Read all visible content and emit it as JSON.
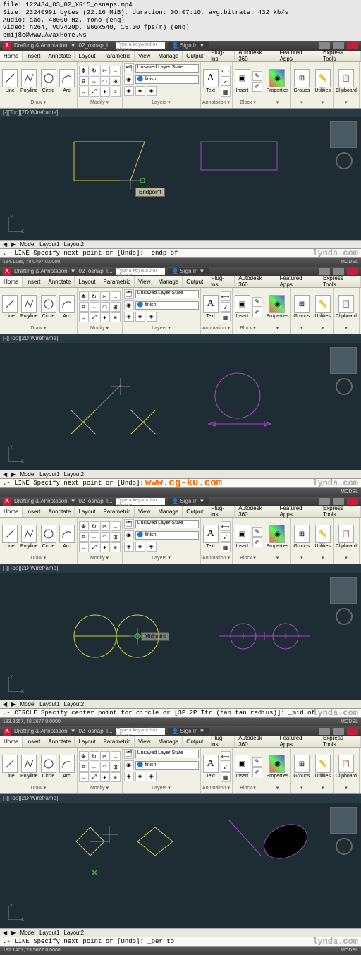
{
  "metadata": {
    "line1": "file: 122434_03_02_XR15_osnaps.mp4",
    "line2": "Size: 23240991 bytes (22.16 MiB), duration: 00:07:10, avg.bitrate: 432 kb/s",
    "line3": "Audio: aac, 48000 Hz, mono (eng)",
    "line4": "Video: h264, yuv420p, 960x540, 15.00 fps(r) (eng)",
    "line5": "emij8o@www.AvaxHome.ws"
  },
  "titlebar": {
    "workspace": "Drafting & Annotation",
    "doc": "02_osnap_l...",
    "search_placeholder": "Type a keyword or phrase",
    "signin": "Sign In"
  },
  "menus": [
    "Home",
    "Insert",
    "Annotate",
    "Layout",
    "Parametric",
    "View",
    "Manage",
    "Output",
    "Plug-ins",
    "Autodesk 360",
    "Featured Apps",
    "Express Tools"
  ],
  "tabs_ribbon": [
    "Home",
    "Insert",
    "Annotate",
    "Layout",
    "Parametric",
    "View",
    "Manage",
    "Output",
    "Plug-ins",
    "Autodesk 360",
    "Featured Apps",
    "Express Tools"
  ],
  "ribbon_groups": {
    "draw": {
      "title": "Draw ▾",
      "tools": [
        "Line",
        "Polyline",
        "Circle",
        "Arc"
      ]
    },
    "modify": {
      "title": "Modify ▾"
    },
    "layers": {
      "title": "Layers ▾",
      "combo": "Unsaved Layer State",
      "finish": "finish"
    },
    "annotation": {
      "title": "Annotation ▾",
      "tools": [
        "A",
        "Text",
        "▼"
      ]
    },
    "block": {
      "title": "Block ▾",
      "tools": [
        "Insert",
        "▼"
      ]
    },
    "prop": {
      "title": "▾",
      "tools": [
        "Properties"
      ]
    },
    "groups": {
      "title": "▾",
      "tools": [
        "Groups"
      ]
    },
    "util": {
      "title": "▾",
      "tools": [
        "Utilities"
      ]
    },
    "clip": {
      "title": "▾",
      "tools": [
        "Clipboard"
      ]
    }
  },
  "viewport_label": "[-][Top][2D Wireframe]",
  "footer_tabs": [
    "Model",
    "Layout1",
    "Layout2"
  ],
  "panes": {
    "1": {
      "cmd": ".- LINE Specify next point or [Undo]: _endp of",
      "coords": "184.1186, 70.0497  0.0000",
      "snap_tip": "Endpoint"
    },
    "2": {
      "cmd": ".- LINE Specify next point or [Undo]:",
      "coords": "",
      "watermark": "www.cg-ku.com"
    },
    "3": {
      "cmd": ".- CIRCLE Specify center point for circle or [3P 2P Ttr (tan tan radius)]: _mid of",
      "coords": "183.8657, 48.2677  0.0000",
      "snap_tip": "Midpoint"
    },
    "4": {
      "cmd": ".- LINE Specify next point or [Undo]: _per to",
      "coords": "182.1407, 23.5677  0.0000"
    }
  },
  "status_right": "MODEL",
  "lynda": "lynda.com"
}
